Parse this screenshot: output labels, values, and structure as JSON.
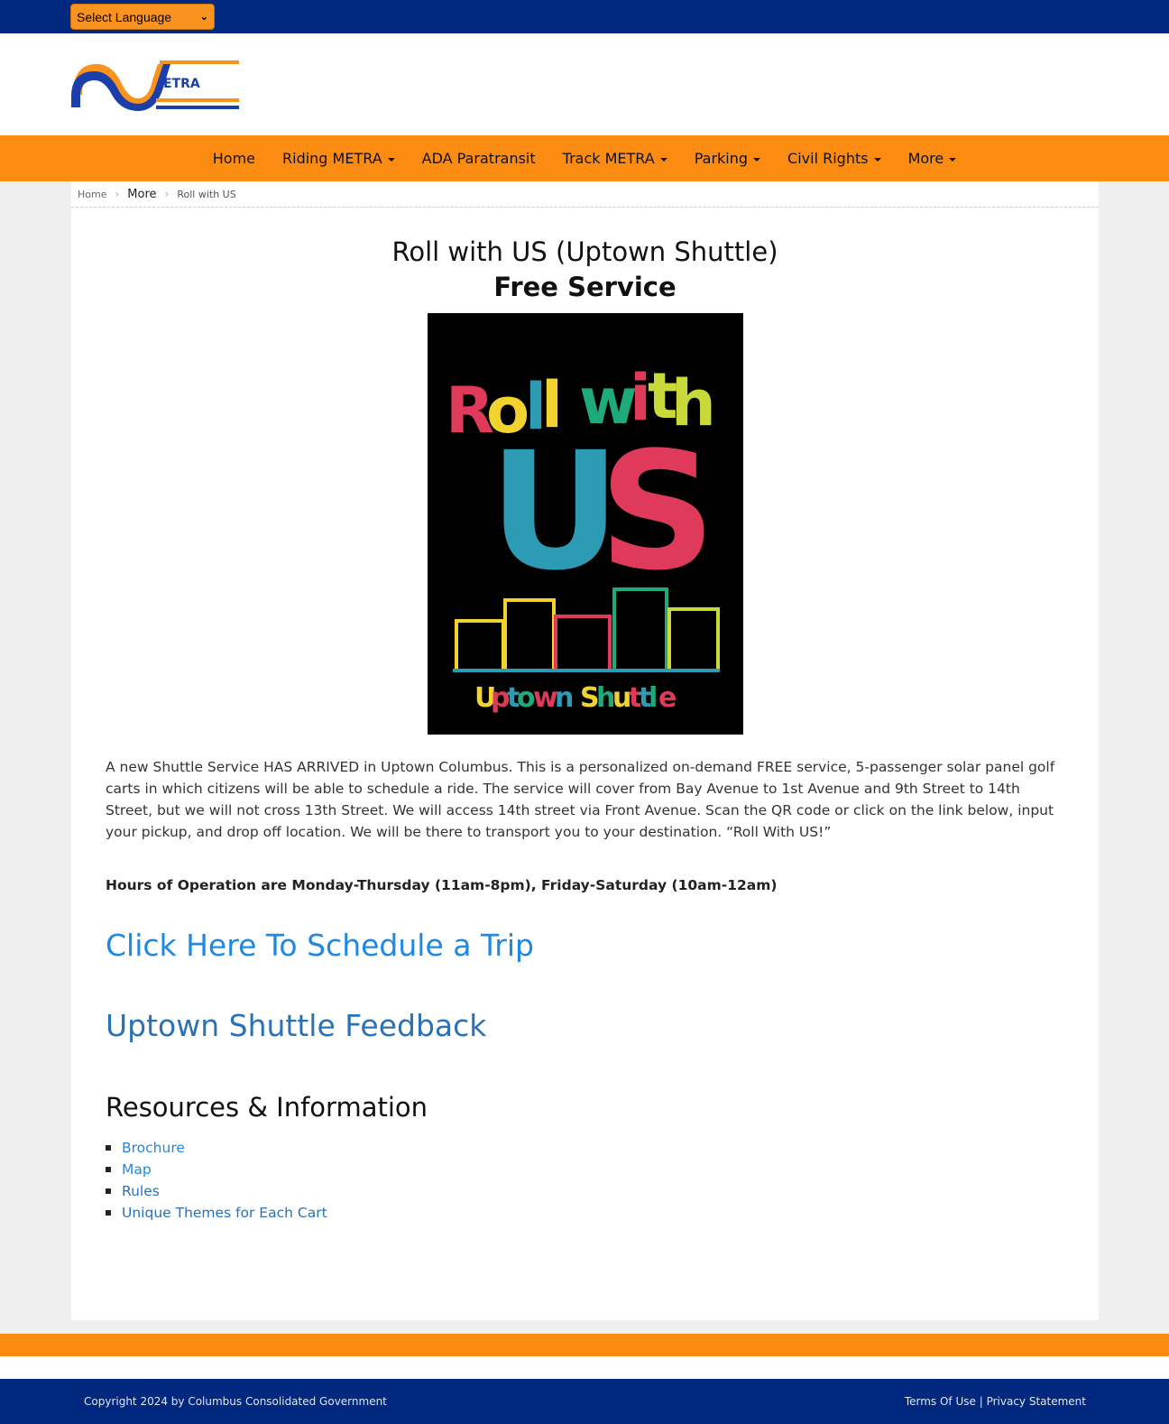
{
  "topbar": {
    "language_select": "Select Language"
  },
  "logo": {
    "alt": "METRA",
    "word": "ETRA",
    "colors": {
      "orange": "#f7931e",
      "blue": "#1b3faa"
    }
  },
  "nav": {
    "items": [
      {
        "label": "Home",
        "dropdown": false
      },
      {
        "label": "Riding METRA",
        "dropdown": true
      },
      {
        "label": "ADA Paratransit",
        "dropdown": false
      },
      {
        "label": "Track METRA",
        "dropdown": true
      },
      {
        "label": "Parking",
        "dropdown": true
      },
      {
        "label": "Civil Rights",
        "dropdown": true
      },
      {
        "label": "More",
        "dropdown": true
      }
    ]
  },
  "breadcrumb": {
    "home": "Home",
    "more": "More",
    "current": "Roll with US"
  },
  "page": {
    "title": "Roll with US (Uptown Shuttle)",
    "subtitle": "Free Service",
    "poster": {
      "line1": [
        "R",
        "o",
        "l",
        "l",
        " ",
        "w",
        "i",
        "t",
        "h"
      ],
      "line2": [
        "U",
        "S"
      ],
      "caption": [
        "U",
        "p",
        "t",
        "o",
        "w",
        "n",
        " ",
        "S",
        "h",
        "u",
        "t",
        "t",
        "l",
        "e"
      ],
      "colors": {
        "pink": "#e03a5a",
        "yellow": "#f2d22e",
        "teal": "#2e9bb5",
        "green": "#1faa7b",
        "lime": "#c9d93a",
        "black": "#000000"
      }
    },
    "body": "A new Shuttle Service HAS ARRIVED in Uptown Columbus. This is a personalized on-demand FREE service, 5-passenger solar panel golf carts in which citizens will be able to schedule a ride. The service will cover from Bay Avenue to 1st Avenue and 9th Street to 14th Street, but we will not cross 13th Street. We will access 14th street via Front Avenue. Scan the QR code or click on the link below, input your pickup, and drop off location. We will be there to transport you to your destination. “Roll With US!”",
    "hours": "Hours of Operation are Monday-Thursday (11am-8pm), Friday-Saturday (10am-12am)",
    "schedule_link": "Click Here To Schedule a Trip",
    "feedback_link": "Uptown Shuttle Feedback",
    "resources_title": "Resources & Information",
    "resources": [
      "Brochure",
      "Map",
      "Rules",
      "Unique Themes for Each Cart"
    ]
  },
  "footer": {
    "copyright": "Copyright 2024 by Columbus Consolidated Government",
    "terms": "Terms Of Use",
    "separator": "|",
    "privacy": "Privacy Statement"
  }
}
